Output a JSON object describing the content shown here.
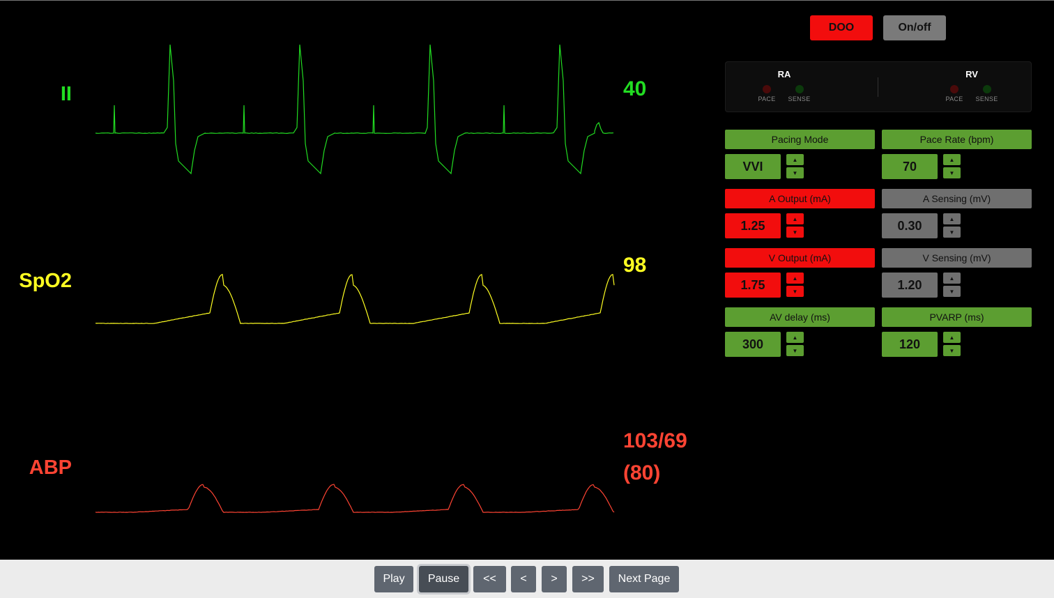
{
  "leads": {
    "ecg": {
      "label": "II",
      "value": "40",
      "color": "#22dd22"
    },
    "spo2": {
      "label": "SpO2",
      "value": "98",
      "color": "#ffff22"
    },
    "abp": {
      "label": "ABP",
      "value_line1": "103/69",
      "value_line2": "(80)",
      "color": "#ff4433"
    }
  },
  "top_buttons": {
    "mode": "DOO",
    "power": "On/off"
  },
  "indicators": {
    "ra": {
      "title": "RA",
      "pace_label": "PACE",
      "sense_label": "SENSE"
    },
    "rv": {
      "title": "RV",
      "pace_label": "PACE",
      "sense_label": "SENSE"
    }
  },
  "params": {
    "pacing_mode": {
      "label": "Pacing Mode",
      "value": "VVI",
      "color": "green"
    },
    "pace_rate": {
      "label": "Pace Rate (bpm)",
      "value": "70",
      "color": "green"
    },
    "a_output": {
      "label": "A Output (mA)",
      "value": "1.25",
      "color": "red"
    },
    "a_sensing": {
      "label": "A Sensing (mV)",
      "value": "0.30",
      "color": "gray"
    },
    "v_output": {
      "label": "V Output (mA)",
      "value": "1.75",
      "color": "red"
    },
    "v_sensing": {
      "label": "V Sensing (mV)",
      "value": "1.20",
      "color": "gray"
    },
    "av_delay": {
      "label": "AV delay (ms)",
      "value": "300",
      "color": "green"
    },
    "pvarp": {
      "label": "PVARP (ms)",
      "value": "120",
      "color": "green"
    }
  },
  "stepper_glyphs": {
    "up": "▲",
    "down": "▼"
  },
  "controls": {
    "play": "Play",
    "pause": "Pause",
    "rewind_fast": "<<",
    "rewind": "<",
    "forward": ">",
    "forward_fast": ">>",
    "next_page": "Next Page"
  },
  "icons": {
    "ra_pace_led": "led-dot-icon",
    "ra_sense_led": "led-dot-icon",
    "rv_pace_led": "led-dot-icon",
    "rv_sense_led": "led-dot-icon"
  }
}
